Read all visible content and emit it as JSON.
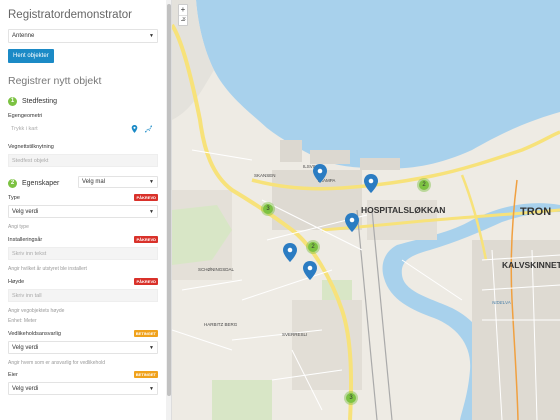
{
  "panel": {
    "title": "Registratordemonstrator",
    "object_type_select": "Antenne",
    "fetch_button": "Hent objekter",
    "register_title": "Registrer nytt objekt",
    "step1": {
      "num": "1",
      "label": "Stedfesting"
    },
    "geometry_label": "Egengeometri",
    "geometry_placeholder": "Trykk i kart",
    "road_link_label": "Vegnettstilknytning",
    "road_link_placeholder": "Stedfest objekt",
    "step2": {
      "num": "2",
      "label": "Egenskaper",
      "template_select": "Velg mal"
    },
    "fields": [
      {
        "label": "Type",
        "badge": "PÅKREVD",
        "value": "Velg verdi",
        "hint": "Angi type"
      },
      {
        "label": "Installeringsår",
        "badge": "PÅKREVD",
        "value": "Skriv inn tekst",
        "hint": "Angir hvilket år utstyret ble installert"
      },
      {
        "label": "Høyde",
        "badge": "PÅKREVD",
        "value": "Skriv inn tall",
        "hint": "Angir vegobjektets høyde",
        "unit": "Enhet: Meter"
      },
      {
        "label": "Vedlikeholdsansvarlig",
        "badge": "BETINGET",
        "value": "Velg verdi",
        "hint": "Angir hvem som er ansvarlig for vedlikehold"
      },
      {
        "label": "Eier",
        "badge": "BETINGET",
        "value": "Velg verdi"
      }
    ],
    "colors": {
      "primary": "#1b8ac6",
      "step": "#7cc242",
      "required": "#d9312a",
      "conditional": "#f0a21c"
    }
  },
  "map": {
    "zoom_in": "+",
    "zoom_out": "−",
    "close_glyph": "×",
    "labels": [
      "HOSPITALSLØKKAN",
      "TRON",
      "KALVSKINNET",
      "ILSVIKA",
      "TRAMPA",
      "SKANSEN",
      "SCHØNINGSDAL",
      "HARBITZ BERG",
      "SVERRESLI",
      "NIDELVA"
    ],
    "clusters": [
      "2",
      "3",
      "2",
      "3"
    ],
    "colors": {
      "water": "#a8d1ec",
      "marker": "#2b7cc2",
      "cluster": "#7cc242",
      "road": "#f7e27a"
    }
  }
}
